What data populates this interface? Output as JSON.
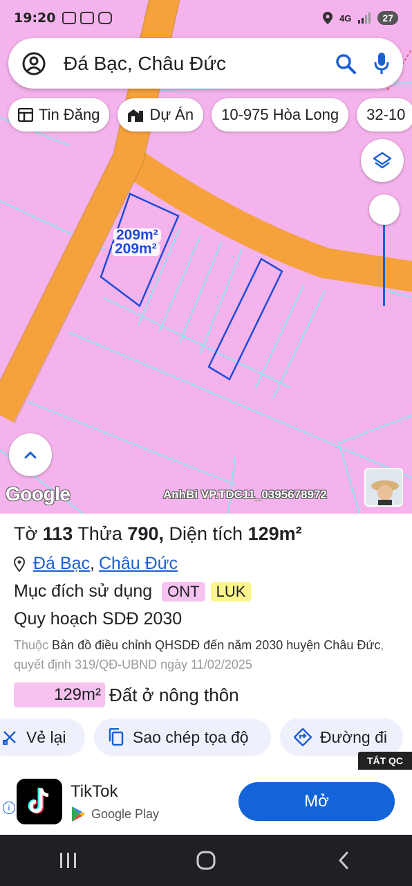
{
  "status_bar": {
    "time": "19:20",
    "network": "4G",
    "battery": "27"
  },
  "search": {
    "text": "Đá Bạc, Châu Đức"
  },
  "chips": [
    {
      "label": "Tin Đăng",
      "icon": "listing-icon"
    },
    {
      "label": "Dự Án",
      "icon": "building-icon"
    },
    {
      "label": "10-975 Hòa Long",
      "icon": ""
    },
    {
      "label": "32-10",
      "icon": ""
    }
  ],
  "map": {
    "parcel_labels": [
      "209m²",
      "209m²"
    ],
    "google_logo": "Google",
    "watermark": "AnhBi VP.TDC11_0395678972",
    "colors": {
      "land": "#f4b3ec",
      "road": "#f5a13c",
      "parcel_line": "#8ee0ee",
      "highlight": "#1e4bd8"
    }
  },
  "parcel": {
    "title_parts": {
      "to_label": "Tờ",
      "to_value": "113",
      "thua_label": "Thửa",
      "thua_value": "790,",
      "area_label": "Diện tích",
      "area_value": "129m²"
    },
    "location": {
      "commune": "Đá Bạc",
      "separator": ",",
      "district": "Châu Đức"
    },
    "purpose_label": "Mục đích sử dụng",
    "purpose_tags": [
      {
        "code": "ONT",
        "color": "#f6c2f0"
      },
      {
        "code": "LUK",
        "color": "#fbf58c"
      }
    ],
    "plan_title": "Quy hoạch SDĐ 2030",
    "plan_desc": {
      "prefix": "Thuộc",
      "map_name": "Bản đồ điều chỉnh QHSDĐ đến năm 2030 huyện Châu Đức",
      "decision": ", quyết định 319/QĐ-UBND ngày 11/02/2025"
    },
    "land_area": "129m²",
    "land_type": "Đất ở nông thôn"
  },
  "actions": [
    {
      "label": "Vẻ lại",
      "icon": "redraw-icon"
    },
    {
      "label": "Sao chép tọa độ",
      "icon": "copy-icon"
    },
    {
      "label": "Đường đi",
      "icon": "directions-icon"
    }
  ],
  "ad": {
    "close_label": "TẮT QC",
    "app_name": "TikTok",
    "store": "Google Play",
    "cta": "Mở"
  }
}
